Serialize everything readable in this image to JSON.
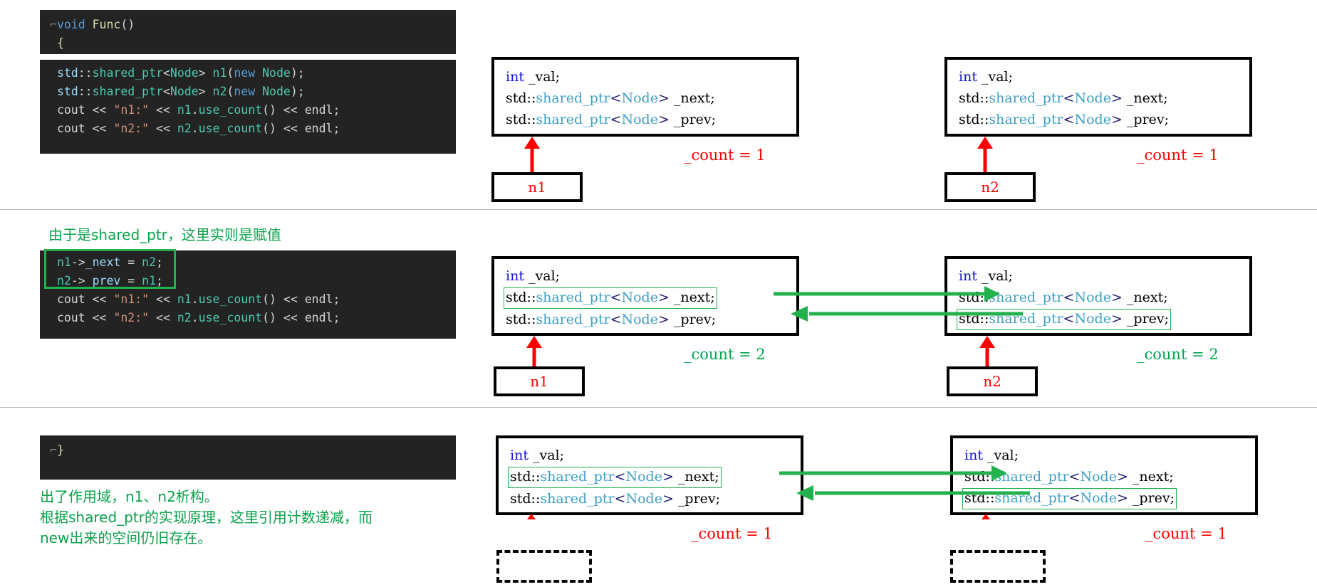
{
  "struct_box": {
    "line1": {
      "type": "int",
      "name": " _val;"
    },
    "line2": {
      "ns": "std::",
      "tpl": "shared_ptr",
      "lt": "<",
      "arg": "Node",
      "gt": ">",
      "name": " _next;"
    },
    "line3": {
      "ns": "std::",
      "tpl": "shared_ptr",
      "lt": "<",
      "arg": "Node",
      "gt": ">",
      "name": " _prev;"
    }
  },
  "colors": {
    "code_bg": "#232323",
    "node_border": "#000000",
    "red": "#fe0000",
    "green": "#22b14c",
    "note_green": "#0aa14b",
    "count_green": "#00a550",
    "type_blue": "#1414d2",
    "tmpl_blue": "#3f9fc4"
  },
  "rows": [
    {
      "id": "row-1",
      "code": {
        "header_lines": [
          "void Func()",
          "{"
        ],
        "body_lines": [
          "std::shared_ptr<Node> n1(new Node);",
          "std::shared_ptr<Node> n2(new Node);",
          "cout << \"n1:\" << n1.use_count() << endl;",
          "cout << \"n2:\" << n2.use_count() << endl;"
        ]
      },
      "left": {
        "count_label": "_count = 1",
        "count_color": "red",
        "pointer_label": "n1",
        "pointer_dashed": false,
        "marked_next": false,
        "marked_prev": false
      },
      "right": {
        "count_label": "_count = 1",
        "count_color": "red",
        "pointer_label": "n2",
        "pointer_dashed": false,
        "marked_next": false,
        "marked_prev": false
      },
      "has_green_links": false,
      "note": null
    },
    {
      "id": "row-2",
      "code": {
        "header_lines": [],
        "body_lines": [
          "n1->_next = n2;",
          "n2->_prev = n1;",
          "cout << \"n1:\" << n1.use_count() << endl;",
          "cout << \"n2:\" << n2.use_count() << endl;"
        ]
      },
      "left": {
        "count_label": "_count = 2",
        "count_color": "green",
        "pointer_label": "n1",
        "pointer_dashed": false,
        "marked_next": true,
        "marked_prev": false
      },
      "right": {
        "count_label": "_count = 2",
        "count_color": "green",
        "pointer_label": "n2",
        "pointer_dashed": false,
        "marked_next": false,
        "marked_prev": true
      },
      "has_green_links": true,
      "note": "由于是shared_ptr，这里实则是赋值"
    },
    {
      "id": "row-3",
      "code": {
        "header_lines": [],
        "body_lines": [
          "}"
        ]
      },
      "left": {
        "count_label": "_count = 1",
        "count_color": "red",
        "pointer_label": "",
        "pointer_dashed": true,
        "marked_next": true,
        "marked_prev": false
      },
      "right": {
        "count_label": "_count = 1",
        "count_color": "red",
        "pointer_label": "",
        "pointer_dashed": true,
        "marked_next": false,
        "marked_prev": true
      },
      "has_green_links": true,
      "note": "出了作用域，n1、n2析构。\n根据shared_ptr的实现原理，这里引用计数递减，而\nnew出来的空间仍旧存在。"
    }
  ]
}
